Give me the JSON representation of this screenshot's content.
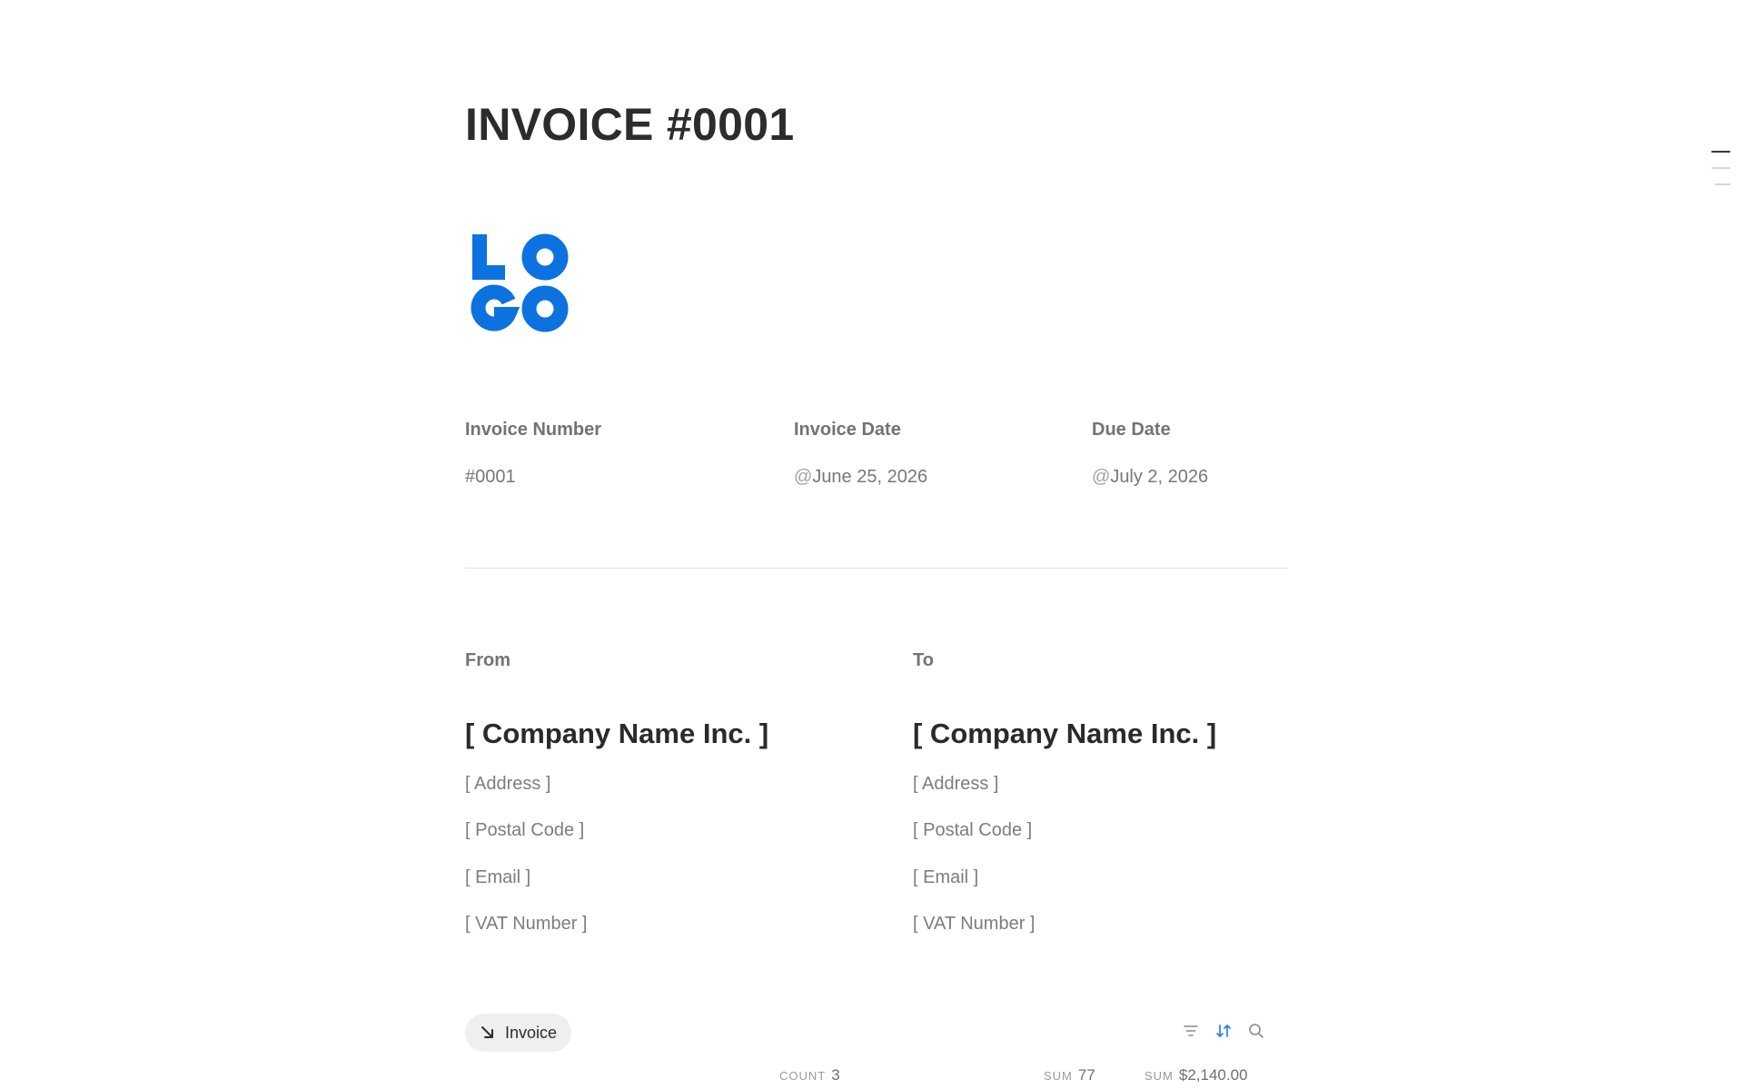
{
  "page": {
    "title": "INVOICE #0001"
  },
  "logo": {
    "line1": "LO",
    "line2": "GO",
    "color": "#0b72e0"
  },
  "details": {
    "invoice_number": {
      "label": "Invoice Number",
      "value": "#0001"
    },
    "invoice_date": {
      "label": "Invoice Date",
      "mention": "@",
      "value": "June 25, 2026"
    },
    "due_date": {
      "label": "Due Date",
      "mention": "@",
      "value": "July 2, 2026"
    }
  },
  "from": {
    "label": "From",
    "company": "[ Company Name Inc. ]",
    "address": "[ Address ]",
    "postal_code": "[ Postal Code ]",
    "email": "[ Email ]",
    "vat": "[ VAT Number ]"
  },
  "to": {
    "label": "To",
    "company": "[ Company Name Inc. ]",
    "address": "[ Address ]",
    "postal_code": "[ Postal Code ]",
    "email": "[ Email ]",
    "vat": "[ VAT Number ]"
  },
  "database": {
    "view_label": "Invoice",
    "view_icon": "arrow-down-right-icon",
    "tools": [
      "filter-icon",
      "sort-icon",
      "search-icon"
    ],
    "sort_active_color": "#2383e2"
  },
  "calculations": {
    "count": {
      "label": "COUNT",
      "value": "3"
    },
    "sum_qty": {
      "label": "SUM",
      "value": "77"
    },
    "sum_amount": {
      "label": "SUM",
      "value": "$2,140.00"
    }
  }
}
